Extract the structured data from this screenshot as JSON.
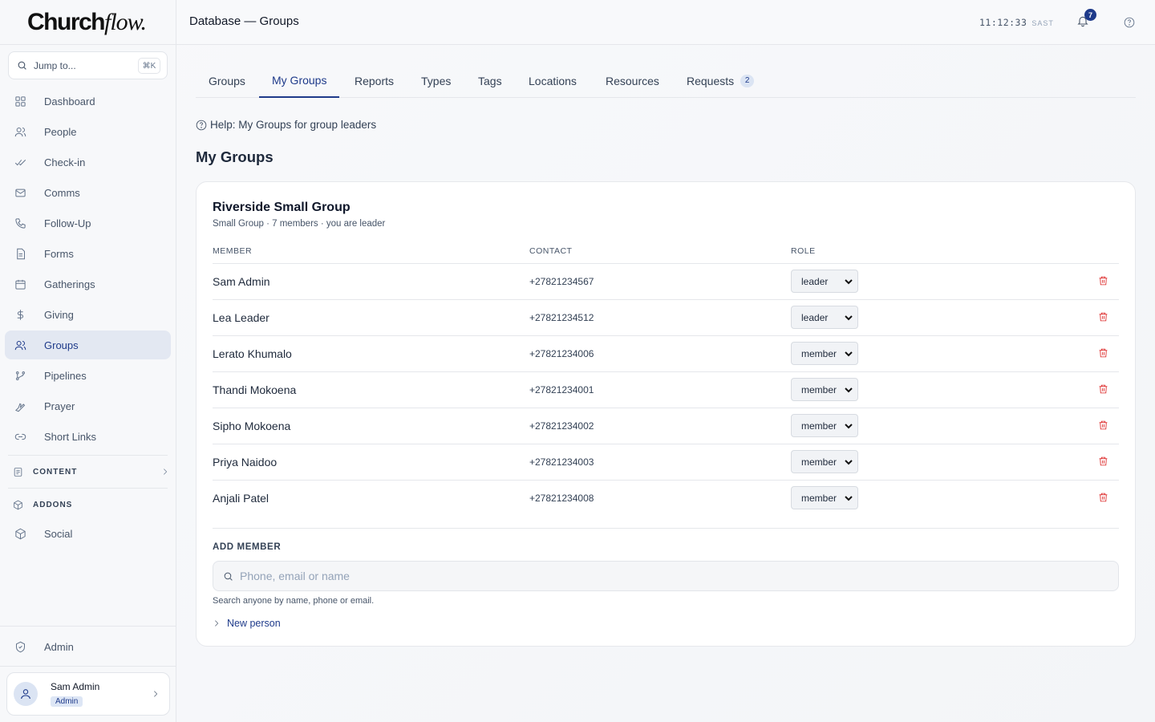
{
  "app": {
    "logo_bold": "Church",
    "logo_italic": "flow."
  },
  "header": {
    "title": "Database — Groups",
    "time": "11:12:33",
    "timezone": "SAST",
    "notification_count": "7"
  },
  "search": {
    "placeholder": "Jump to...",
    "shortcut": "⌘K"
  },
  "sidebar": {
    "items": [
      {
        "label": "Dashboard",
        "icon": "grid-icon"
      },
      {
        "label": "People",
        "icon": "users-icon"
      },
      {
        "label": "Check-in",
        "icon": "double-check-icon"
      },
      {
        "label": "Comms",
        "icon": "mail-icon"
      },
      {
        "label": "Follow-Up",
        "icon": "phone-icon"
      },
      {
        "label": "Forms",
        "icon": "document-icon"
      },
      {
        "label": "Gatherings",
        "icon": "calendar-icon"
      },
      {
        "label": "Giving",
        "icon": "dollar-icon"
      },
      {
        "label": "Groups",
        "icon": "user-group-icon",
        "active": true
      },
      {
        "label": "Pipelines",
        "icon": "branch-icon"
      },
      {
        "label": "Prayer",
        "icon": "hands-icon"
      },
      {
        "label": "Short Links",
        "icon": "link-icon"
      }
    ],
    "content_section": "CONTENT",
    "addons_section": "ADDONS",
    "addons_items": [
      {
        "label": "Social",
        "icon": "cube-icon"
      }
    ],
    "admin_label": "Admin",
    "user": {
      "name": "Sam Admin",
      "badge": "Admin"
    }
  },
  "tabs": [
    {
      "label": "Groups"
    },
    {
      "label": "My Groups",
      "active": true
    },
    {
      "label": "Reports"
    },
    {
      "label": "Types"
    },
    {
      "label": "Tags"
    },
    {
      "label": "Locations"
    },
    {
      "label": "Resources"
    },
    {
      "label": "Requests",
      "count": "2"
    }
  ],
  "help_text": "Help: My Groups for group leaders",
  "page_title": "My Groups",
  "group": {
    "name": "Riverside Small Group",
    "subtitle": "Small Group · 7 members · you are leader",
    "columns": {
      "member": "MEMBER",
      "contact": "CONTACT",
      "role": "ROLE"
    },
    "members": [
      {
        "name": "Sam Admin",
        "contact": "+27821234567",
        "role": "leader"
      },
      {
        "name": "Lea Leader",
        "contact": "+27821234512",
        "role": "leader"
      },
      {
        "name": "Lerato Khumalo",
        "contact": "+27821234006",
        "role": "member"
      },
      {
        "name": "Thandi Mokoena",
        "contact": "+27821234001",
        "role": "member"
      },
      {
        "name": "Sipho Mokoena",
        "contact": "+27821234002",
        "role": "member"
      },
      {
        "name": "Priya Naidoo",
        "contact": "+27821234003",
        "role": "member"
      },
      {
        "name": "Anjali Patel",
        "contact": "+27821234008",
        "role": "member"
      }
    ]
  },
  "add_member": {
    "label": "ADD MEMBER",
    "placeholder": "Phone, email or name",
    "hint": "Search anyone by name, phone or email.",
    "new_person": "New person"
  },
  "colors": {
    "accent": "#1e3a8a",
    "danger": "#dc2626",
    "active_bg": "#e3e8f2"
  }
}
